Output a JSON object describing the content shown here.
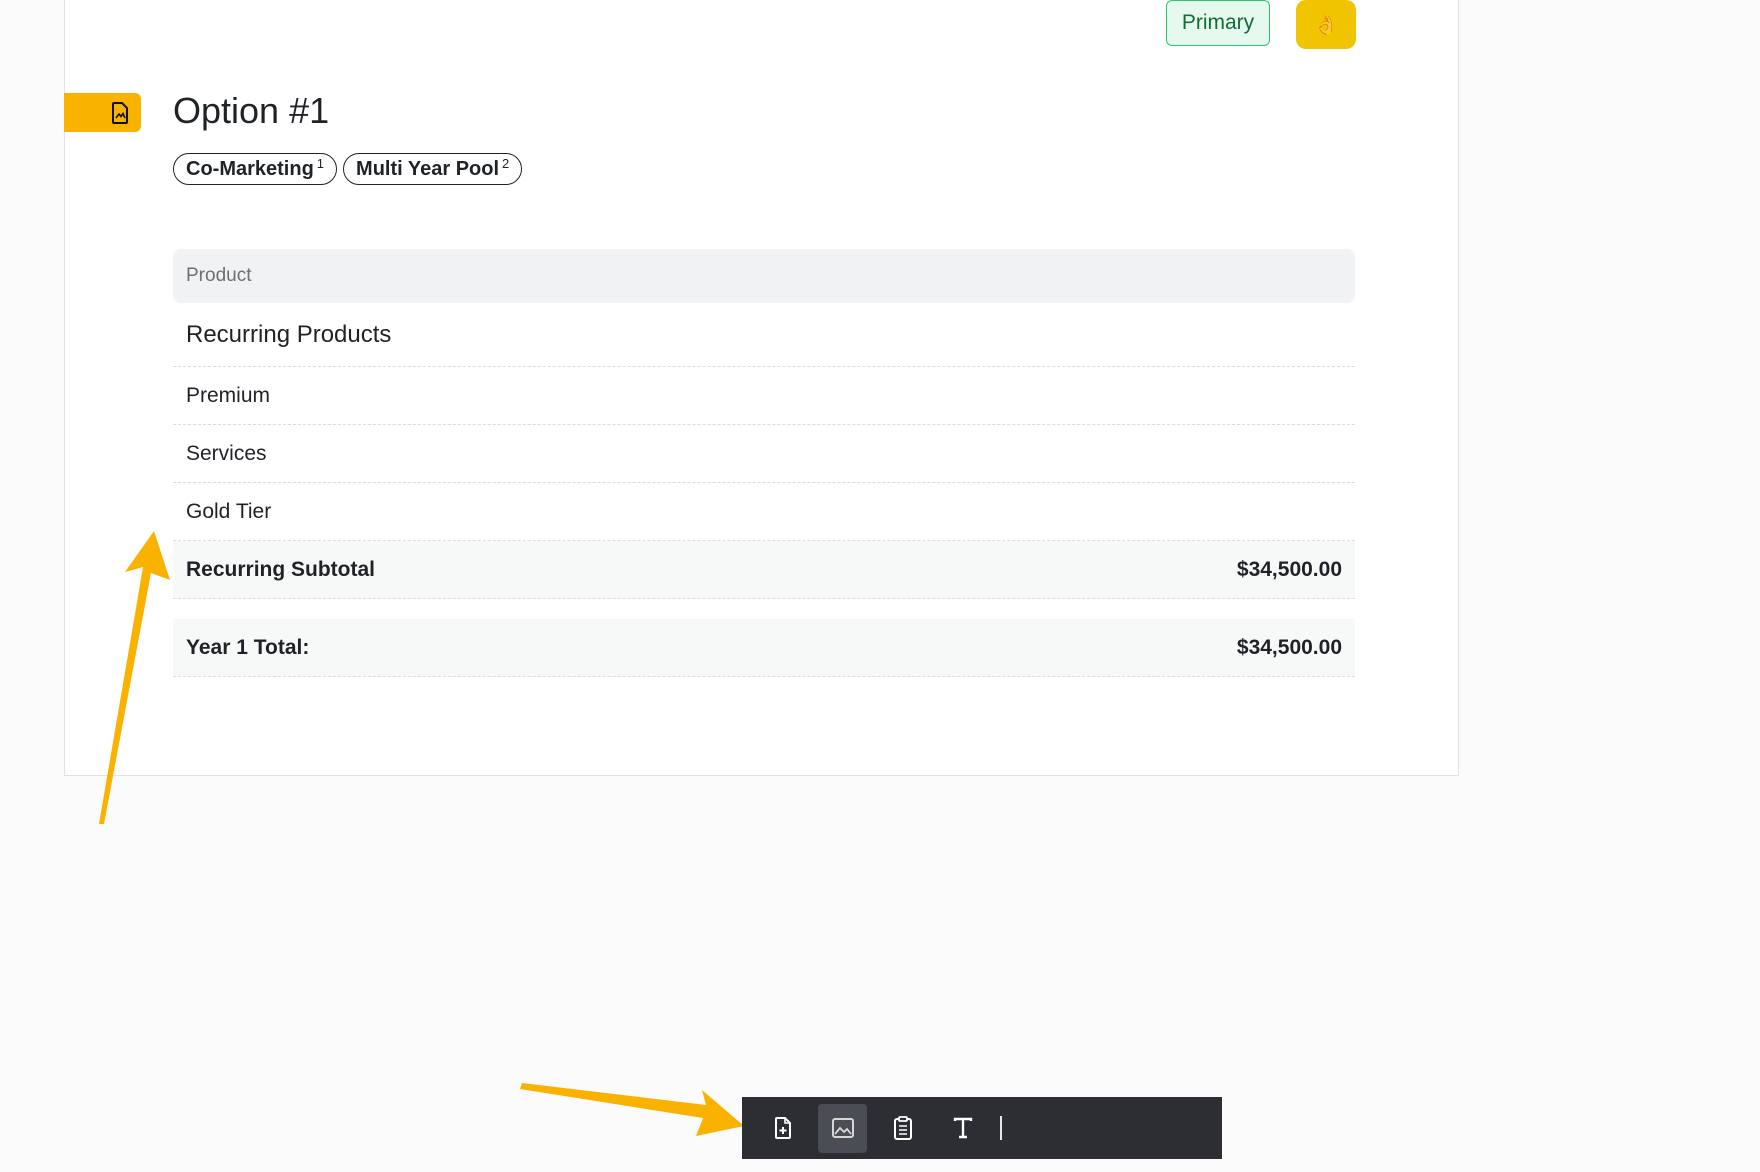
{
  "header": {
    "status_badge": "Primary",
    "hand_icon": "ok-hand-icon"
  },
  "option": {
    "title": "Option #1",
    "tags": [
      {
        "label": "Co-Marketing",
        "count": "1"
      },
      {
        "label": "Multi Year Pool",
        "count": "2"
      }
    ]
  },
  "table": {
    "column_header": "Product",
    "group_title": "Recurring Products",
    "items": [
      "Premium",
      "Services",
      "Gold Tier"
    ],
    "subtotal_label": "Recurring Subtotal",
    "subtotal_value": "$34,500.00",
    "total_label": "Year 1 Total:",
    "total_value": "$34,500.00"
  },
  "toolbar": {
    "tools": [
      "add-document-icon",
      "image-icon",
      "clipboard-icon",
      "text-icon"
    ],
    "active_tool": "image-icon"
  },
  "colors": {
    "accent_orange": "#f9b200",
    "primary_green": "#31c46a",
    "toolbar_bg": "#2c2e33"
  }
}
